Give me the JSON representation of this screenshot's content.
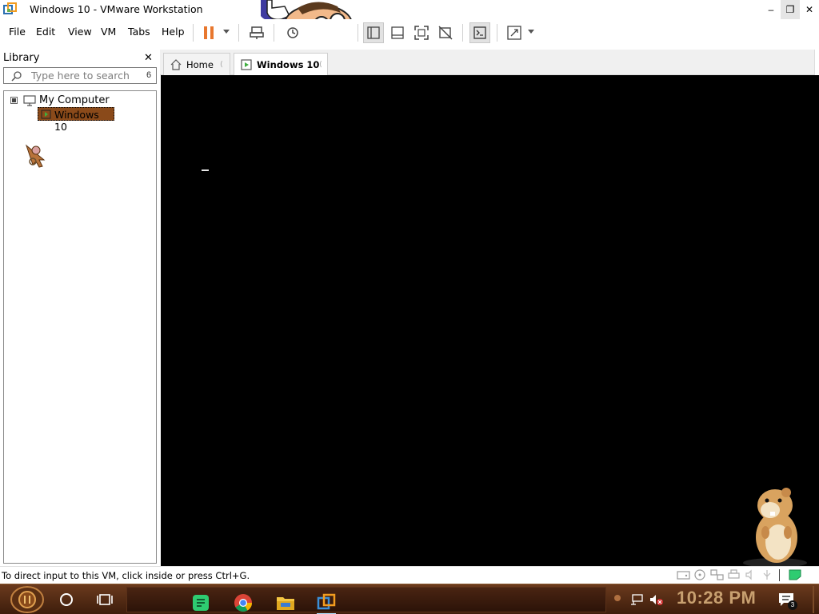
{
  "window": {
    "title": "Windows 10 - VMware Workstation",
    "minimize_glyph": "–",
    "maximize_glyph": "❐",
    "close_glyph": "✕"
  },
  "menu": {
    "items": [
      "File",
      "Edit",
      "View",
      "VM",
      "Tabs",
      "Help"
    ]
  },
  "toolbar": {
    "buttons": [
      {
        "icon": "pause-icon",
        "color": "#e8772e"
      },
      {
        "icon": "send-ctrl-alt-del-icon"
      },
      {
        "icon": "snapshot-icon"
      },
      {
        "icon": "show-library-icon",
        "active": true
      },
      {
        "icon": "thumbnail-bar-icon"
      },
      {
        "icon": "full-screen-icon"
      },
      {
        "icon": "unity-icon"
      },
      {
        "icon": "console-view-icon",
        "active": true
      },
      {
        "icon": "stretch-guest-icon"
      }
    ]
  },
  "library": {
    "title": "Library",
    "close_glyph": "✕",
    "search": {
      "placeholder": "Type here to search",
      "trailing_char": "6"
    },
    "tree": {
      "root_label": "My Computer",
      "children": [
        {
          "label": "Windows 10",
          "selected": true,
          "highlight_color": "#8a4a1a"
        }
      ]
    }
  },
  "tabs": [
    {
      "label": "Home",
      "icon": "home-icon",
      "close_glyph": "⟨"
    },
    {
      "label": "Windows 10",
      "icon": "vm-icon",
      "active": true,
      "close_glyph": "⟨"
    }
  ],
  "vm_display": {
    "background": "#000000"
  },
  "statusbar": {
    "text": "To direct input to this VM, click inside or press Ctrl+G."
  },
  "taskbar": {
    "clock": "10:28 PM",
    "notification_count": "3",
    "apps": [
      {
        "name": "sticky-notes-app-icon",
        "color": "#2ecc71"
      },
      {
        "name": "chrome-app-icon"
      },
      {
        "name": "file-explorer-app-icon",
        "color": "#f4c542"
      },
      {
        "name": "vmware-app-icon",
        "active": true
      }
    ],
    "colors": {
      "bar": "#4a2412",
      "clock": "#c8a070"
    }
  }
}
